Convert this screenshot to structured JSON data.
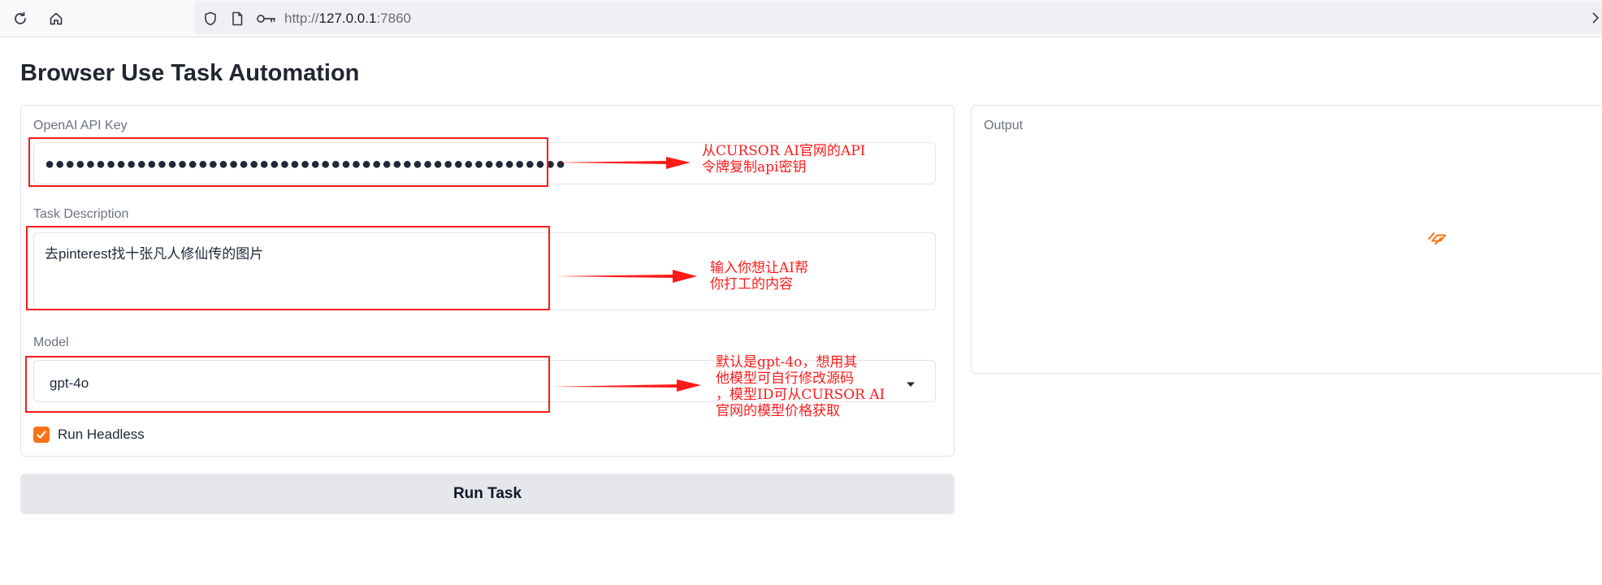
{
  "browser": {
    "url_scheme": "http://",
    "url_host": "127.0.0.1",
    "url_port": ":7860",
    "icons": [
      "reload-icon",
      "home-icon",
      "shield-icon",
      "page-icon",
      "key-icon"
    ]
  },
  "page": {
    "title": "Browser Use Task Automation"
  },
  "form": {
    "api_key_label": "OpenAI API Key",
    "api_key_value": "●●●●●●●●●●●●●●●●●●●●●●●●●●●●●●●●●●●●●●●●●●●●●●●●●●●",
    "task_label": "Task Description",
    "task_value": "去pinterest找十张凡人修仙传的图片",
    "model_label": "Model",
    "model_value": "gpt-4o",
    "headless_label": "Run Headless",
    "headless_checked": true,
    "run_button": "Run Task"
  },
  "output": {
    "label": "Output"
  },
  "annotations": {
    "note_api_key": "从CURSOR AI官网的API\n令牌复制api密钥",
    "note_task": "输入你想让AI帮\n你打工的内容",
    "note_model": "默认是gpt-4o，想用其\n他模型可自行修改源码\n，模型ID可从CURSOR AI\n官网的模型价格获取"
  },
  "colors": {
    "accent": "#f97316",
    "annotation": "#ff1a1a",
    "button_bg": "#e5e7eb"
  }
}
